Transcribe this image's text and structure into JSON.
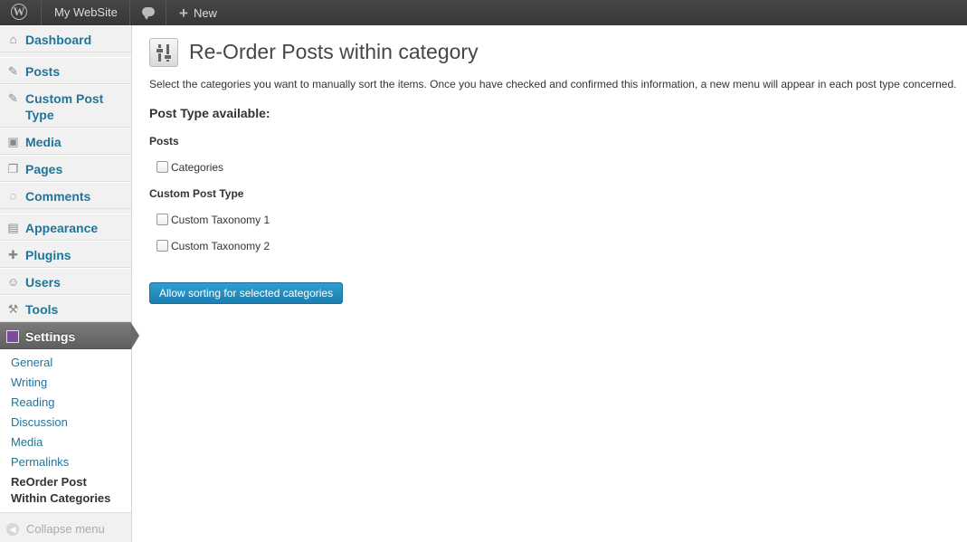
{
  "admin_bar": {
    "site_name": "My WebSite",
    "new_label": "New"
  },
  "sidebar": {
    "items": [
      {
        "label": "Dashboard",
        "icon": "home-icon"
      },
      {
        "label": "Posts",
        "icon": "pin-icon"
      },
      {
        "label": "Custom Post Type",
        "icon": "pin-icon"
      },
      {
        "label": "Media",
        "icon": "media-icon"
      },
      {
        "label": "Pages",
        "icon": "pages-icon"
      },
      {
        "label": "Comments",
        "icon": "comment-icon"
      },
      {
        "label": "Appearance",
        "icon": "appearance-icon"
      },
      {
        "label": "Plugins",
        "icon": "plugin-icon"
      },
      {
        "label": "Users",
        "icon": "users-icon"
      },
      {
        "label": "Tools",
        "icon": "tools-icon"
      },
      {
        "label": "Settings",
        "icon": "settings-icon"
      }
    ],
    "settings_submenu": [
      "General",
      "Writing",
      "Reading",
      "Discussion",
      "Media",
      "Permalinks",
      "ReOrder Post Within Categories"
    ],
    "collapse_label": "Collapse menu"
  },
  "main": {
    "title": "Re-Order Posts within category",
    "intro": "Select the categories you want to manually sort the items. Once you have checked and confirmed this information, a new menu will appear in each post type concerned.",
    "section_title": "Post Type available:",
    "groups": [
      {
        "title": "Posts",
        "options": [
          {
            "label": "Categories",
            "checked": false
          }
        ]
      },
      {
        "title": "Custom Post Type",
        "options": [
          {
            "label": "Custom Taxonomy 1",
            "checked": false
          },
          {
            "label": "Custom Taxonomy 2",
            "checked": false
          }
        ]
      }
    ],
    "submit_label": "Allow sorting for selected categories"
  },
  "colors": {
    "link": "#21759b",
    "button": "#2e9fd2",
    "admin_bar": "#464646"
  }
}
